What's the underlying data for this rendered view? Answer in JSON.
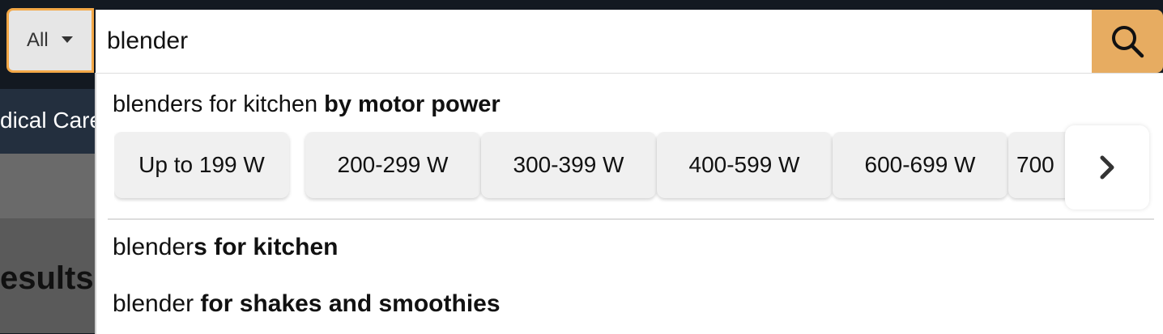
{
  "background": {
    "nav_fragment": "dical Care",
    "results_fragment": "esults"
  },
  "search": {
    "scope_label": "All",
    "query": "blender",
    "search_icon": "magnifier-icon"
  },
  "dropdown": {
    "heading": {
      "prefix": "blenders for kitchen ",
      "bold": "by motor power"
    },
    "chips": [
      "Up to 199 W",
      "200-299 W",
      "300-399 W",
      "400-599 W",
      "600-699 W",
      "700"
    ],
    "next_icon": "chevron-right-icon",
    "suggestions": [
      {
        "prefix": "blender",
        "bold": "s for kitchen"
      },
      {
        "prefix": "blender ",
        "bold": "for shakes and smoothies"
      }
    ]
  }
}
